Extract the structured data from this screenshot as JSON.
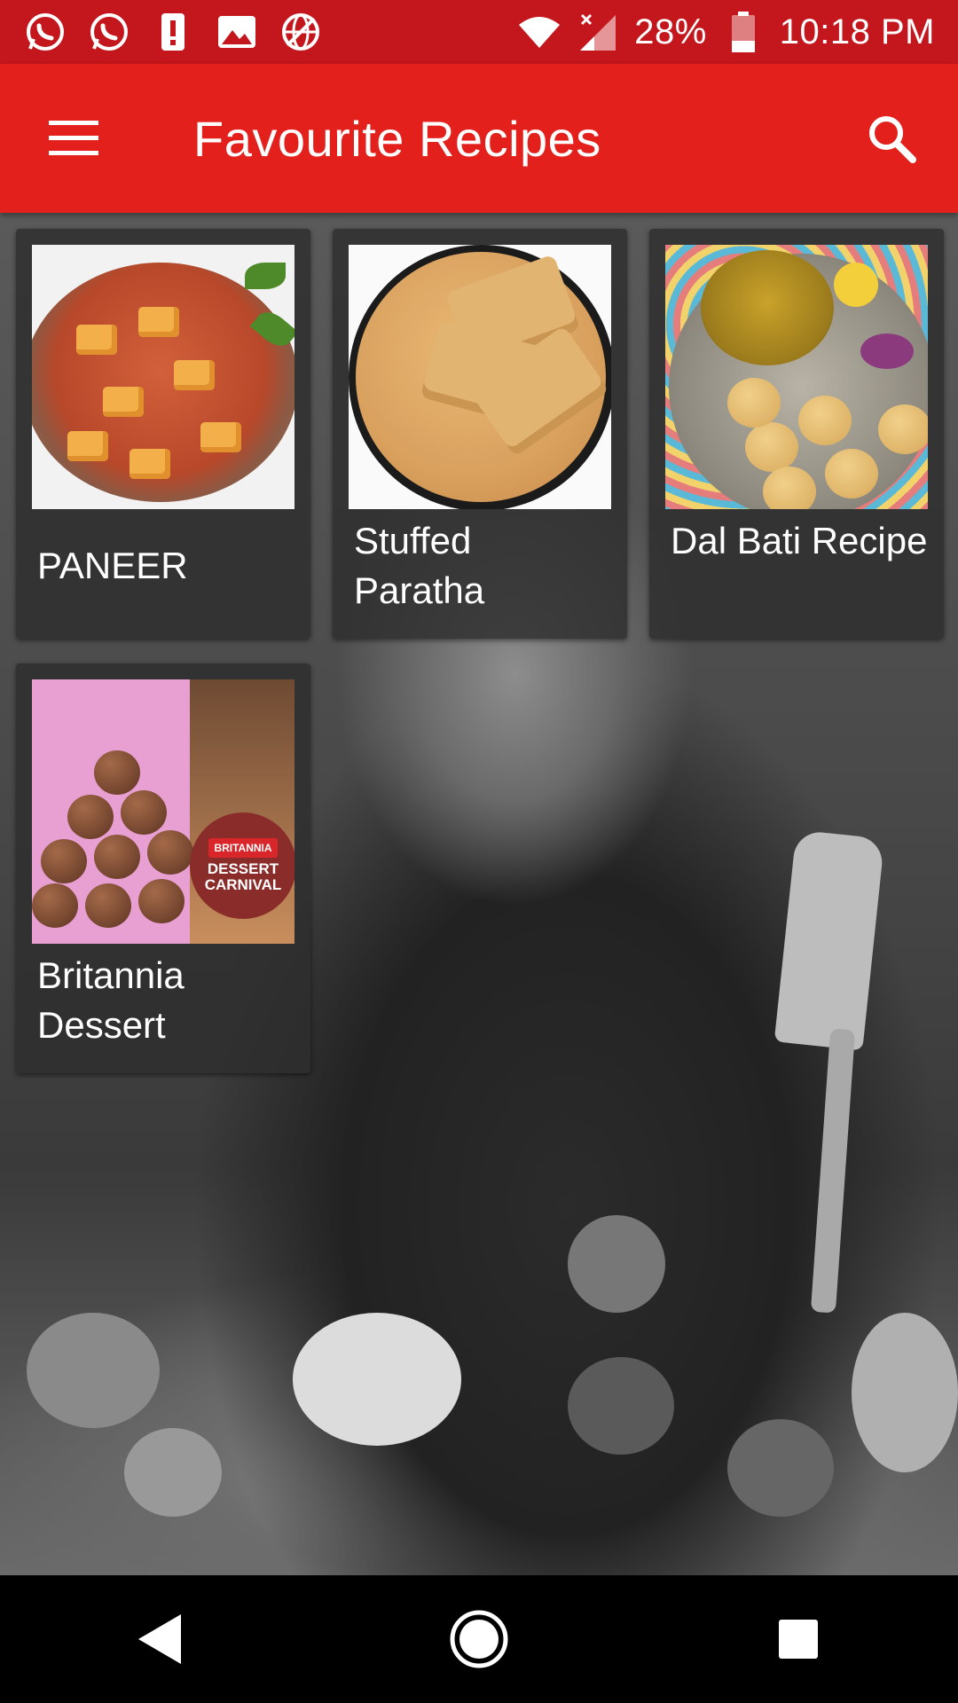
{
  "status_bar": {
    "battery_percent": "28%",
    "time": "10:18 PM",
    "icons_left": [
      "whatsapp-icon",
      "whatsapp-icon",
      "alert-icon",
      "image-icon",
      "vpn-globe-icon"
    ],
    "icons_right": [
      "wifi-icon",
      "signal-off-icon",
      "battery-icon"
    ]
  },
  "app_bar": {
    "title": "Favourite Recipes",
    "background": "#e3201c"
  },
  "recipes": [
    {
      "title": "PANEER"
    },
    {
      "title": "Stuffed Paratha"
    },
    {
      "title": "Dal Bati Recipe"
    },
    {
      "title": "Britannia Dessert"
    }
  ],
  "dessert_packaging": {
    "brand": "BRITANNIA",
    "line1": "DESSERT",
    "line2": "CARNIVAL"
  },
  "nav_bar": {
    "buttons": [
      "back",
      "home",
      "recents"
    ]
  }
}
